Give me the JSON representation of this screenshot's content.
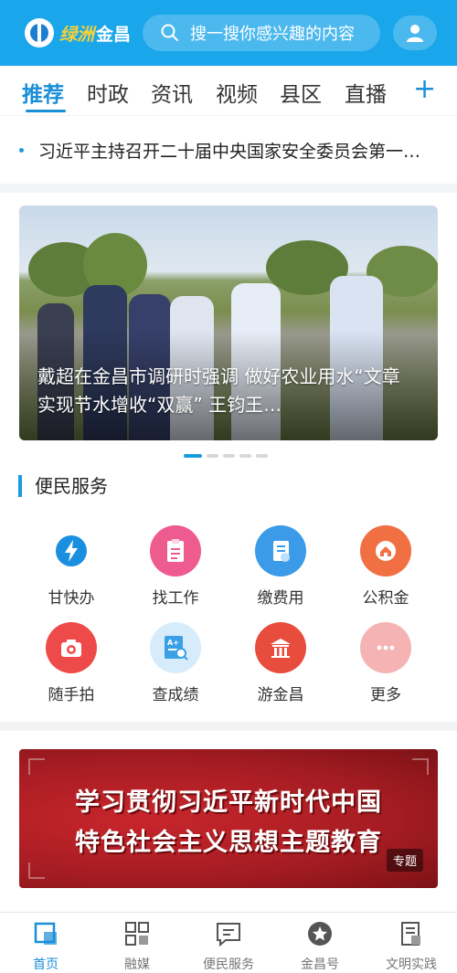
{
  "header": {
    "logo_script": "绿洲",
    "logo_text": "金昌",
    "search_placeholder": "搜一搜你感兴趣的内容"
  },
  "tabs": [
    {
      "label": "推荐",
      "active": true
    },
    {
      "label": "时政"
    },
    {
      "label": "资讯"
    },
    {
      "label": "视频"
    },
    {
      "label": "县区"
    },
    {
      "label": "直播"
    }
  ],
  "headline": "习近平主持召开二十届中央国家安全委员会第一次会议",
  "banner": {
    "caption": "戴超在金昌市调研时强调 做好农业用水“文章 实现节水增收“双赢” 王钧王…",
    "slide_count": 5,
    "active_slide": 1
  },
  "services": {
    "title": "便民服务",
    "items": [
      {
        "label": "甘快办",
        "icon": "lightning-icon",
        "color": "#1a8fe0"
      },
      {
        "label": "找工作",
        "icon": "clipboard-icon",
        "color": "#ee5b8f"
      },
      {
        "label": "缴费用",
        "icon": "bill-icon",
        "color": "#3b9be8"
      },
      {
        "label": "公积金",
        "icon": "house-coin-icon",
        "color": "#f07043"
      },
      {
        "label": "随手拍",
        "icon": "camera-icon",
        "color": "#ef4a4a"
      },
      {
        "label": "查成绩",
        "icon": "grade-search-icon",
        "color": "#3aa0e6"
      },
      {
        "label": "游金昌",
        "icon": "temple-icon",
        "color": "#e84c3d"
      },
      {
        "label": "更多",
        "icon": "more-icon",
        "color": "#f3a3a3"
      }
    ]
  },
  "promo": {
    "line1": "学习贯彻习近平新时代中国",
    "line2": "特色社会主义思想主题教育",
    "tag": "专题"
  },
  "tabbar": [
    {
      "label": "首页",
      "icon": "home-icon",
      "active": true
    },
    {
      "label": "融媒",
      "icon": "grid-icon"
    },
    {
      "label": "便民服务",
      "icon": "message-icon"
    },
    {
      "label": "金昌号",
      "icon": "star-badge-icon"
    },
    {
      "label": "文明实践",
      "icon": "document-icon"
    }
  ]
}
